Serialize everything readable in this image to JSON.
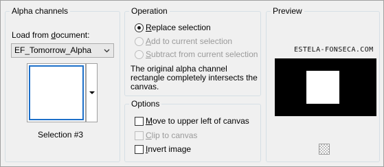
{
  "alpha_channels": {
    "title": "Alpha channels",
    "load_label_prefix": "Load from ",
    "load_label_accel": "d",
    "load_label_suffix": "ocument:",
    "document_value": "EF_Tomorrow_Alpha",
    "selection_label": "Selection #3"
  },
  "operation": {
    "title": "Operation",
    "options": [
      {
        "accel": "R",
        "rest": "eplace selection",
        "selected": true,
        "enabled": true
      },
      {
        "accel": "A",
        "rest": "dd to current selection",
        "selected": false,
        "enabled": false
      },
      {
        "accel": "S",
        "rest": "ubtract from current selection",
        "selected": false,
        "enabled": false
      }
    ],
    "description_lines": [
      "The original alpha channel",
      "rectangle completely intersects the",
      "canvas."
    ]
  },
  "options": {
    "title": "Options",
    "items": [
      {
        "accel": "M",
        "rest": "ove to upper left of canvas",
        "checked": false,
        "enabled": true
      },
      {
        "accel": "C",
        "rest": "lip to canvas",
        "checked": false,
        "enabled": false
      },
      {
        "accel": "I",
        "rest": "nvert image",
        "checked": false,
        "enabled": true
      }
    ]
  },
  "preview": {
    "title": "Preview",
    "watermark": "ESTELA-FONSECA.COM",
    "background_color": "#000000",
    "selection_color": "#ffffff"
  },
  "icons": {
    "combo_arrow": "chevron-down-icon",
    "swatch_dropdown": "triangle-down-icon",
    "transparency": "checkerboard-icon"
  },
  "colors": {
    "focus_border": "#1c6fc9",
    "dialog_bg": "#f0f0f0"
  }
}
